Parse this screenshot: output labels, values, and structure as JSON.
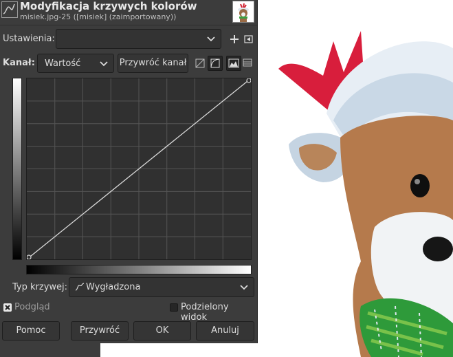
{
  "header": {
    "title": "Modyfikacja krzywych kolorów",
    "subtitle": "misiek.jpg-25 ([misiek] (zaimportowany))"
  },
  "settings": {
    "label": "Ustawienia:",
    "value": ""
  },
  "channel": {
    "label": "Kanał:",
    "value": "Wartość",
    "reset_label": "Przywróć kanał"
  },
  "curve": {
    "points": [
      [
        0,
        0
      ],
      [
        255,
        255
      ]
    ],
    "grid_divisions": 8
  },
  "curve_type": {
    "label": "Typ krzywej:",
    "value": "Wygładzona"
  },
  "options": {
    "preview_label": "Podgląd",
    "preview_checked": true,
    "split_label": "Podzielony widok",
    "split_checked": false
  },
  "buttons": {
    "help": "Pomoc",
    "reset": "Przywróć",
    "ok": "OK",
    "cancel": "Anuluj"
  },
  "icons": {
    "header": "curves-icon",
    "add": "add-icon",
    "menu": "menu-arrow-icon",
    "linear": "linear-histogram-icon",
    "log": "log-histogram-icon",
    "histogram": "histogram-icon",
    "bars": "bars-icon"
  }
}
